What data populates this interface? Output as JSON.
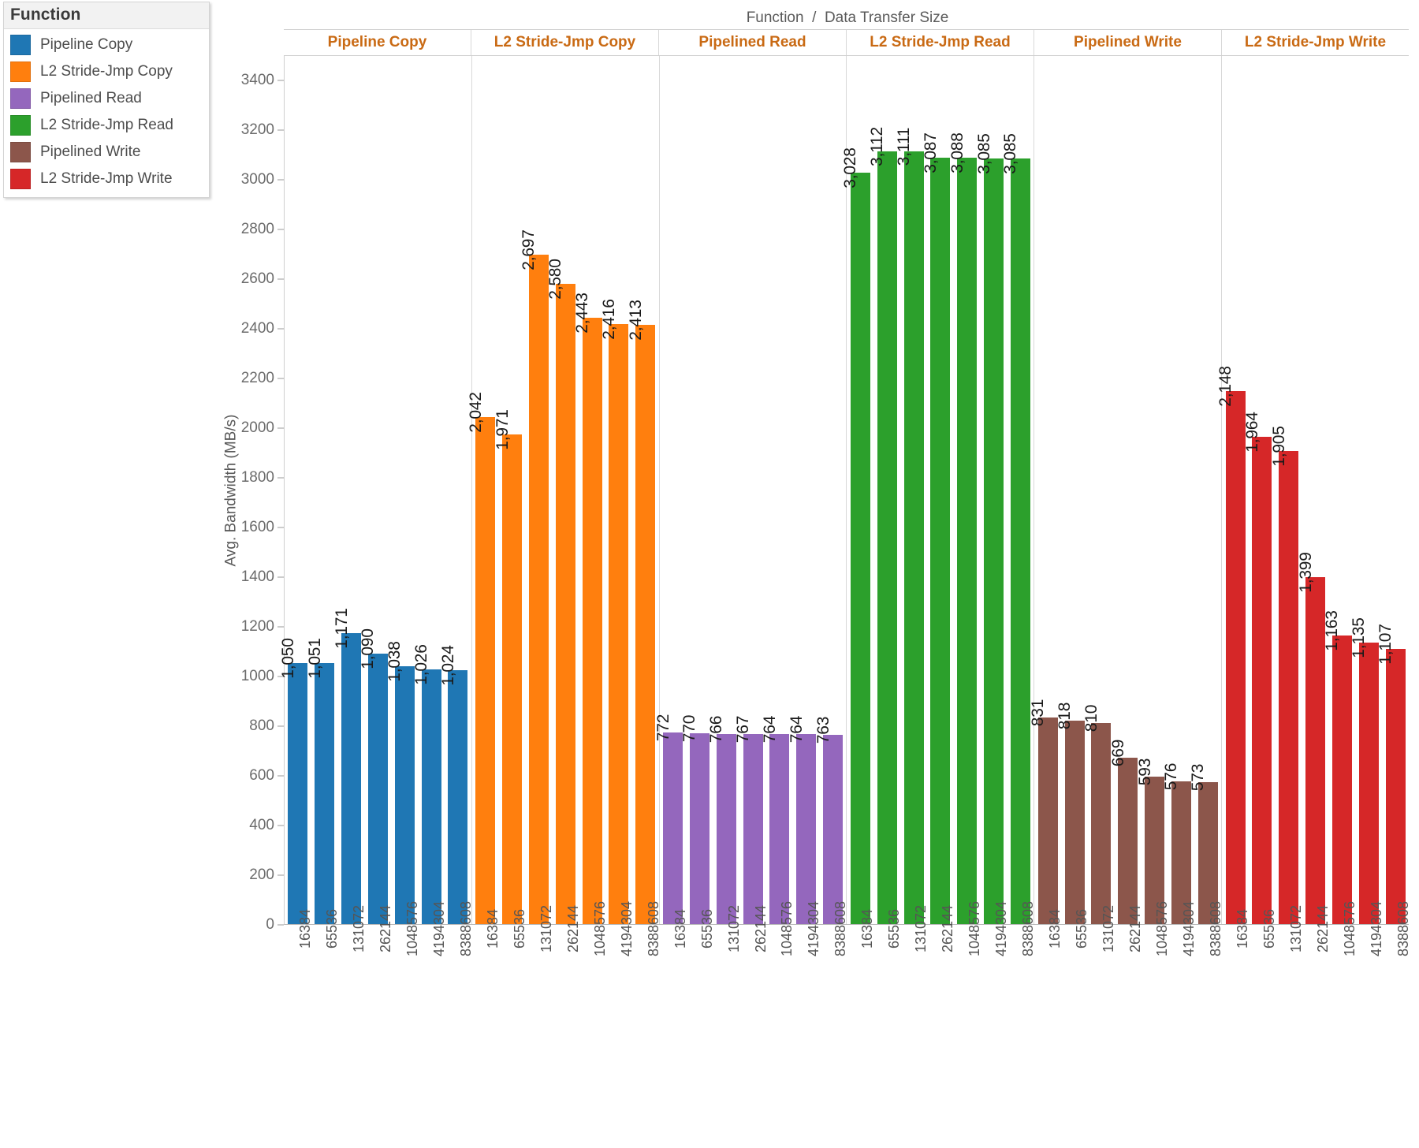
{
  "legend": {
    "title": "Function",
    "items": [
      {
        "label": "Pipeline Copy",
        "color": "#1f77b4"
      },
      {
        "label": "L2 Stride-Jmp Copy",
        "color": "#ff7f0e"
      },
      {
        "label": "Pipelined Read",
        "color": "#9467bd"
      },
      {
        "label": "L2 Stride-Jmp Read",
        "color": "#2ca02c"
      },
      {
        "label": "Pipelined Write",
        "color": "#8c564b"
      },
      {
        "label": "L2 Stride-Jmp Write",
        "color": "#d62728"
      }
    ]
  },
  "chart_title": "Function  /  Data Transfer Size",
  "y_axis_title": "Avg. Bandwidth (MB/s)",
  "y_ticks": [
    "3400",
    "3200",
    "3000",
    "2800",
    "2600",
    "2400",
    "2200",
    "2000",
    "1800",
    "1600",
    "1400",
    "1200",
    "1000",
    "800",
    "600",
    "400",
    "200",
    "0"
  ],
  "chart_data": {
    "type": "bar",
    "title": "Function  /  Data Transfer Size",
    "xlabel": "Data Transfer Size",
    "ylabel": "Avg. Bandwidth (MB/s)",
    "ylim": [
      0,
      3500
    ],
    "grid": false,
    "legend_position": "top-left",
    "categories": [
      "16384",
      "65536",
      "131072",
      "262144",
      "1048576",
      "4194304",
      "8388608"
    ],
    "panels": [
      {
        "name": "Pipeline Copy",
        "color": "#1f77b4",
        "values": [
          1050,
          1051,
          1171,
          1090,
          1038,
          1026,
          1024
        ],
        "labels": [
          "1,050",
          "1,051",
          "1,171",
          "1,090",
          "1,038",
          "1,026",
          "1,024"
        ]
      },
      {
        "name": "L2 Stride-Jmp Copy",
        "color": "#ff7f0e",
        "values": [
          2042,
          1971,
          2697,
          2580,
          2443,
          2416,
          2413
        ],
        "labels": [
          "2,042",
          "1,971",
          "2,697",
          "2,580",
          "2,443",
          "2,416",
          "2,413"
        ]
      },
      {
        "name": "Pipelined Read",
        "color": "#9467bd",
        "values": [
          772,
          770,
          766,
          767,
          764,
          764,
          763
        ],
        "labels": [
          "772",
          "770",
          "766",
          "767",
          "764",
          "764",
          "763"
        ]
      },
      {
        "name": "L2 Stride-Jmp Read",
        "color": "#2ca02c",
        "values": [
          3028,
          3112,
          3111,
          3087,
          3088,
          3085,
          3085
        ],
        "labels": [
          "3,028",
          "3,112",
          "3,111",
          "3,087",
          "3,088",
          "3,085",
          "3,085"
        ]
      },
      {
        "name": "Pipelined Write",
        "color": "#8c564b",
        "values": [
          831,
          818,
          810,
          669,
          593,
          576,
          573
        ],
        "labels": [
          "831",
          "818",
          "810",
          "669",
          "593",
          "576",
          "573"
        ]
      },
      {
        "name": "L2 Stride-Jmp Write",
        "color": "#d62728",
        "values": [
          2148,
          1964,
          1905,
          1399,
          1163,
          1135,
          1107
        ],
        "labels": [
          "2,148",
          "1,964",
          "1,905",
          "1,399",
          "1,163",
          "1,135",
          "1,107"
        ]
      }
    ]
  }
}
